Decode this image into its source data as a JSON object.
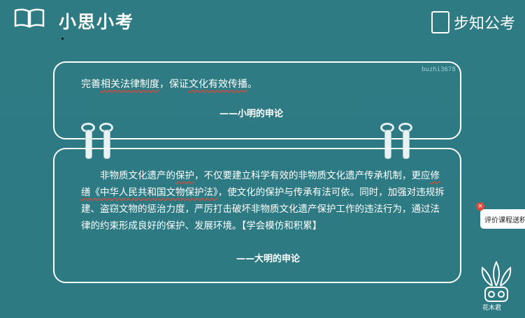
{
  "header": {
    "title": "小思小考",
    "brand": "步知公考"
  },
  "watermark": "buzhi3678",
  "card_top": {
    "quote_parts": [
      "完善",
      "相关法律制度",
      "，保证",
      "文化有效传播",
      "。"
    ],
    "signature": "——小明的申论"
  },
  "card_bottom": {
    "para_parts": [
      "非物质文化遗产的",
      "保护",
      "，不仅要建立科学有效的非物质文化遗产传承机制，更应",
      "修缮《中华人民共和国文物保护法》",
      "，使文化的保护与传承有法可依。同时，加强对违规拆建、盗窃文物的惩治力度，严厉打击破坏非物质文化遗产保护工作的违法行为，通过法律的约束形成良好的保护、发展环境。【学会模仿和积累】"
    ],
    "signature": "——大明的申论"
  },
  "rate_tab": {
    "label": "评价课程送积分",
    "close": "×"
  },
  "logo_text": "花木君",
  "colors": {
    "background": "#2f7d86",
    "underline": "#d24b3a"
  }
}
